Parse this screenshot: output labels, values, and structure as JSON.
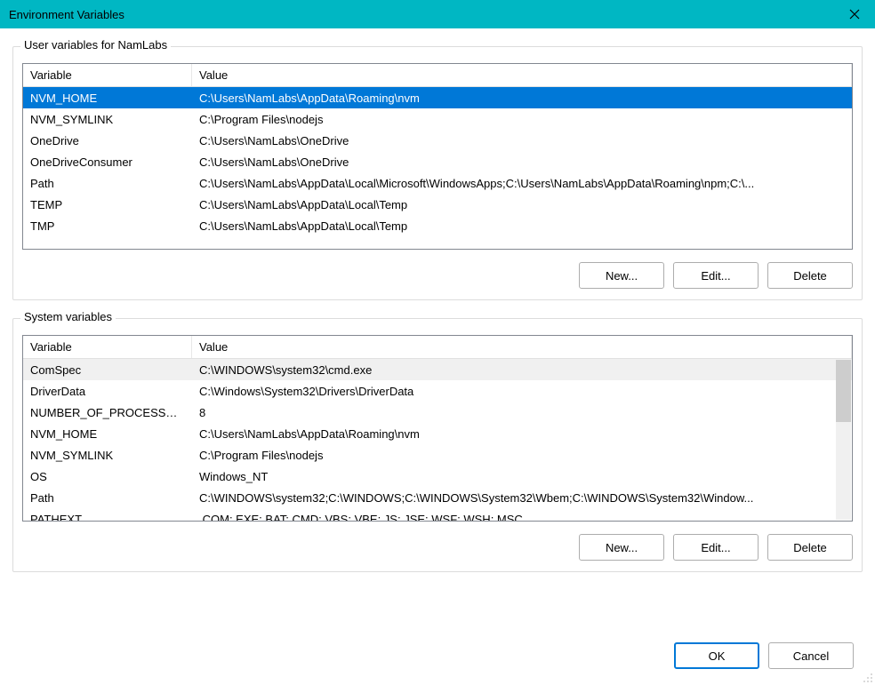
{
  "window": {
    "title": "Environment Variables"
  },
  "userSection": {
    "label": "User variables for NamLabs",
    "columns": {
      "var": "Variable",
      "val": "Value"
    },
    "rows": [
      {
        "var": "NVM_HOME",
        "val": "C:\\Users\\NamLabs\\AppData\\Roaming\\nvm",
        "selected": true
      },
      {
        "var": "NVM_SYMLINK",
        "val": "C:\\Program Files\\nodejs"
      },
      {
        "var": "OneDrive",
        "val": "C:\\Users\\NamLabs\\OneDrive"
      },
      {
        "var": "OneDriveConsumer",
        "val": "C:\\Users\\NamLabs\\OneDrive"
      },
      {
        "var": "Path",
        "val": "C:\\Users\\NamLabs\\AppData\\Local\\Microsoft\\WindowsApps;C:\\Users\\NamLabs\\AppData\\Roaming\\npm;C:\\..."
      },
      {
        "var": "TEMP",
        "val": "C:\\Users\\NamLabs\\AppData\\Local\\Temp"
      },
      {
        "var": "TMP",
        "val": "C:\\Users\\NamLabs\\AppData\\Local\\Temp"
      }
    ],
    "buttons": {
      "new": "New...",
      "edit": "Edit...",
      "delete": "Delete"
    }
  },
  "systemSection": {
    "label": "System variables",
    "columns": {
      "var": "Variable",
      "val": "Value"
    },
    "rows": [
      {
        "var": "ComSpec",
        "val": "C:\\WINDOWS\\system32\\cmd.exe",
        "hover": true
      },
      {
        "var": "DriverData",
        "val": "C:\\Windows\\System32\\Drivers\\DriverData"
      },
      {
        "var": "NUMBER_OF_PROCESSORS",
        "val": "8"
      },
      {
        "var": "NVM_HOME",
        "val": "C:\\Users\\NamLabs\\AppData\\Roaming\\nvm"
      },
      {
        "var": "NVM_SYMLINK",
        "val": "C:\\Program Files\\nodejs"
      },
      {
        "var": "OS",
        "val": "Windows_NT"
      },
      {
        "var": "Path",
        "val": "C:\\WINDOWS\\system32;C:\\WINDOWS;C:\\WINDOWS\\System32\\Wbem;C:\\WINDOWS\\System32\\Window..."
      },
      {
        "var": "PATHEXT",
        "val": ".COM;.EXE;.BAT;.CMD;.VBS;.VBE;.JS;.JSE;.WSF;.WSH;.MSC"
      }
    ],
    "buttons": {
      "new": "New...",
      "edit": "Edit...",
      "delete": "Delete"
    }
  },
  "footer": {
    "ok": "OK",
    "cancel": "Cancel"
  }
}
